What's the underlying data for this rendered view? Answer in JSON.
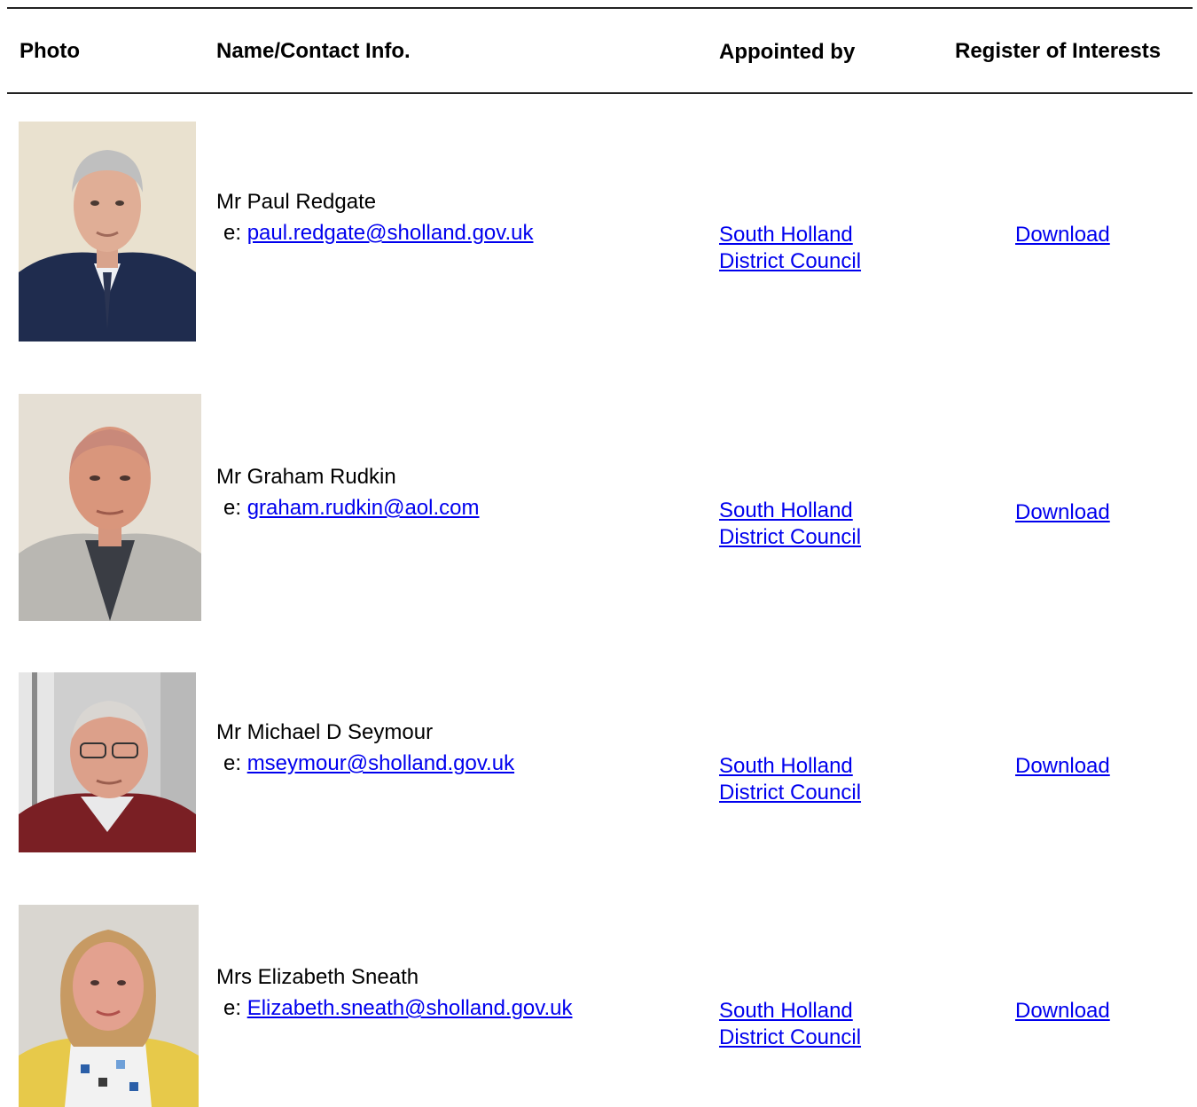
{
  "table": {
    "headers": {
      "photo": "Photo",
      "name": "Name/Contact Info.",
      "appointed": "Appointed by",
      "register": "Register of Interests"
    },
    "email_prefix": "e:",
    "rows": [
      {
        "name": "Mr Paul Redgate",
        "email": "paul.redgate@sholland.gov.uk",
        "appointed_line1": "South Holland",
        "appointed_line2": "District Council",
        "register_link": "Download"
      },
      {
        "name": "Mr Graham Rudkin",
        "email": "graham.rudkin@aol.com",
        "appointed_line1": "South Holland",
        "appointed_line2": "District Council",
        "register_link": "Download"
      },
      {
        "name": "Mr Michael D Seymour",
        "email": "mseymour@sholland.gov.uk",
        "appointed_line1": "South Holland",
        "appointed_line2": "District Council",
        "register_link": "Download"
      },
      {
        "name": "Mrs Elizabeth Sneath",
        "email": "Elizabeth.sneath@sholland.gov.uk",
        "appointed_line1": "South Holland",
        "appointed_line2": "District Council",
        "register_link": "Download"
      }
    ]
  },
  "colors": {
    "link": "#0000ee",
    "rule": "#222222",
    "text": "#000000"
  }
}
